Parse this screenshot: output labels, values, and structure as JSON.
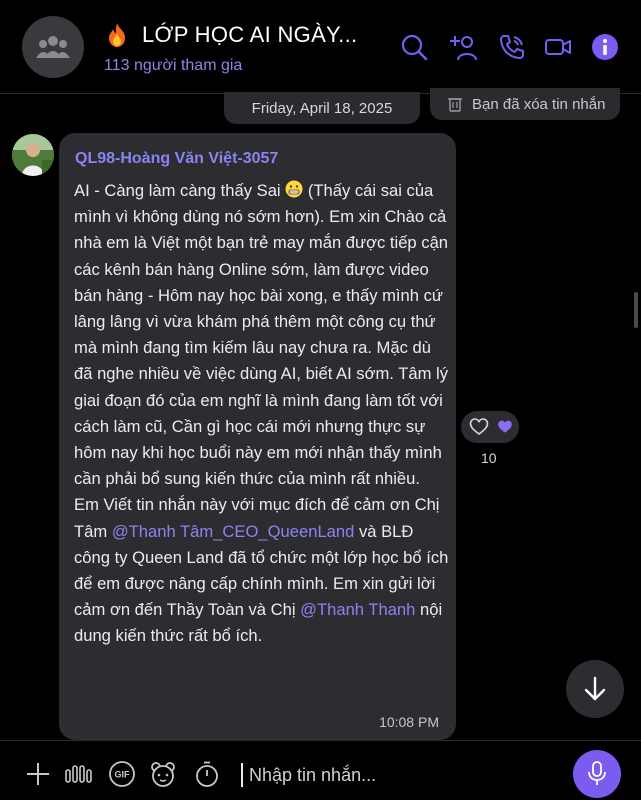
{
  "header": {
    "title": "LỚP HỌC AI NGÀY...",
    "members": "113 người tham gia",
    "icons": [
      "search-icon",
      "add-member-icon",
      "voice-call-icon",
      "video-call-icon",
      "info-icon"
    ],
    "accent": "#7b5bf0"
  },
  "timeline": {
    "date": "Friday, April 18, 2025",
    "deleted_notice": "Bạn đã xóa tin nhắn"
  },
  "message": {
    "sender": "QL98-Hoàng Văn Việt-3057",
    "text_part1": "AI - Càng làm càng thấy Sai",
    "text_part2": " (Thấy cái sai của mình vì không dùng nó sớm hơn). Em xin Chào cả nhà em là Việt một bạn trẻ may mắn được tiếp cận các kênh bán hàng Online sớm, làm được video bán hàng - Hôm nay học bài xong, e thấy mình cứ lâng lâng vì vừa khám phá thêm một công cụ thứ mà mình đang tìm kiếm lâu nay chưa ra. Mặc dù đã nghe nhiều về việc dùng AI, biết AI sớm. Tâm lý giai đoạn đó của em nghĩ là mình đang làm tốt với cách làm cũ, Cần gì học cái mới nhưng thực sự hôm nay khi học buổi này em mới nhận thấy mình cần phải bổ sung kiến thức của mình rất nhiều. Em Viết tin nhắn này với mục đích để cảm ơn Chị Tâm ",
    "mention1": "@Thanh Tâm_CEO_QueenLand",
    "text_part3": " và BLĐ công ty Queen Land đã tổ chức một lớp học bổ ích để em được nâng cấp chính mình. Em xin gửi lời cảm ơn đến Thầy Toàn và Chị ",
    "mention2": "@Thanh Thanh",
    "text_part4": " nội dung kiến thức rất bổ ích.",
    "time": "10:08 PM",
    "reaction_count": "10"
  },
  "composer": {
    "placeholder": "Nhập tin nhắn...",
    "icons": [
      "plus-icon",
      "voice-wave-icon",
      "gif-icon",
      "sticker-icon",
      "timer-icon",
      "mic-icon"
    ]
  }
}
